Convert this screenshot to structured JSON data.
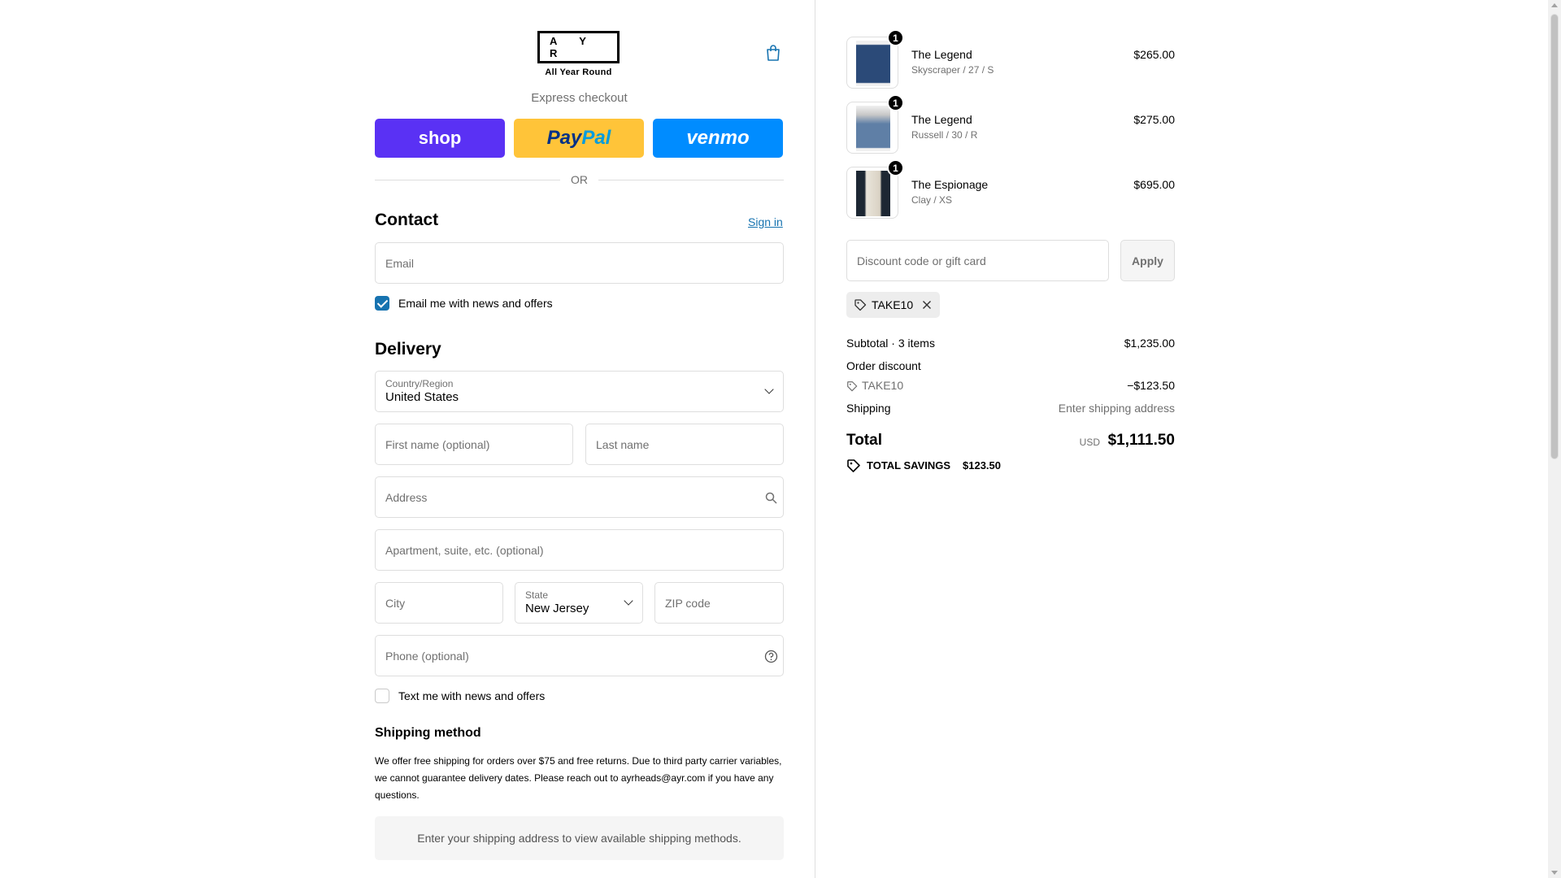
{
  "header": {
    "logo_letters": "A Y R",
    "logo_sub": "All Year Round",
    "express_label": "Express checkout",
    "shop_label": "shop",
    "paypal_a": "Pay",
    "paypal_b": "Pal",
    "venmo_label": "venmo",
    "or_label": "OR"
  },
  "contact": {
    "title": "Contact",
    "sign_in": "Sign in",
    "email_placeholder": "Email",
    "news_label": "Email me with news and offers",
    "news_checked": true
  },
  "delivery": {
    "title": "Delivery",
    "country_label": "Country/Region",
    "country_value": "United States",
    "first_name_placeholder": "First name (optional)",
    "last_name_placeholder": "Last name",
    "address_placeholder": "Address",
    "apartment_placeholder": "Apartment, suite, etc. (optional)",
    "city_placeholder": "City",
    "state_label": "State",
    "state_value": "New Jersey",
    "zip_placeholder": "ZIP code",
    "phone_placeholder": "Phone (optional)",
    "text_label": "Text me with news and offers",
    "text_checked": false
  },
  "shipping": {
    "title": "Shipping method",
    "note": "We offer free shipping for orders over $75 and free returns. Due to third party carrier variables, we cannot guarantee delivery dates. Please reach out to ayrheads@ayr.com if you have any questions.",
    "placeholder": "Enter your shipping address to view available shipping methods."
  },
  "cart": {
    "items": [
      {
        "name": "The Legend",
        "variant": "Skyscraper / 27 / S",
        "price": "$265.00",
        "qty": "1",
        "color": "#2b4a78"
      },
      {
        "name": "The Legend",
        "variant": "Russell / 30 / R",
        "price": "$275.00",
        "qty": "1",
        "color": "#5f7fa6"
      },
      {
        "name": "The Espionage",
        "variant": "Clay / XS",
        "price": "$695.00",
        "qty": "1",
        "color": "#d9d2c4"
      }
    ],
    "discount_placeholder": "Discount code or gift card",
    "apply_label": "Apply",
    "applied_code": "TAKE10"
  },
  "summary": {
    "subtotal_label": "Subtotal · 3 items",
    "subtotal_value": "$1,235.00",
    "order_discount_label": "Order discount",
    "discount_code": "TAKE10",
    "discount_value": "−$123.50",
    "shipping_label": "Shipping",
    "shipping_value": "Enter shipping address",
    "total_label": "Total",
    "currency": "USD",
    "total_value": "$1,111.50",
    "savings_label": "TOTAL SAVINGS",
    "savings_value": "$123.50"
  }
}
